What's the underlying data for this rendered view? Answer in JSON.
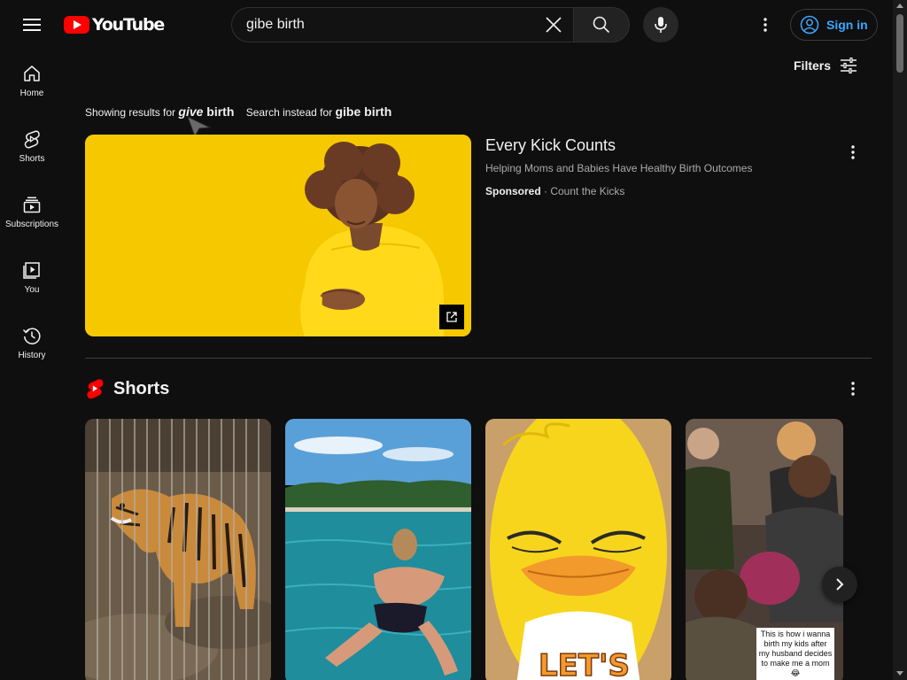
{
  "header": {
    "logo_text": "YouTube",
    "search_value": "gibe birth",
    "signin_label": "Sign in"
  },
  "sidebar": {
    "items": [
      {
        "label": "Home"
      },
      {
        "label": "Shorts"
      },
      {
        "label": "Subscriptions"
      },
      {
        "label": "You"
      },
      {
        "label": "History"
      }
    ]
  },
  "filters": {
    "label": "Filters"
  },
  "correction": {
    "showing_prefix": "Showing results for ",
    "corrected_fix": "give",
    "corrected_rest": " birth",
    "instead_prefix": "Search instead for ",
    "original_query": "gibe birth"
  },
  "ad": {
    "title": "Every Kick Counts",
    "description": "Helping Moms and Babies Have Healthy Birth Outcomes",
    "sponsored": "Sponsored",
    "separator": " · ",
    "advertiser": "Count the Kicks"
  },
  "shorts": {
    "title": "Shorts",
    "items": [
      {
        "scene": "tiger"
      },
      {
        "scene": "swimmer"
      },
      {
        "scene": "cartoon-duck",
        "shirt_text": "LET'S"
      },
      {
        "scene": "family",
        "caption": "This is how i wanna birth my kids after my husband decides to make me a mom 😂"
      }
    ]
  },
  "colors": {
    "background": "#0f0f0f",
    "brand_red": "#ff0000",
    "link_blue": "#3ea6ff",
    "ad_yellow": "#f5c800"
  }
}
